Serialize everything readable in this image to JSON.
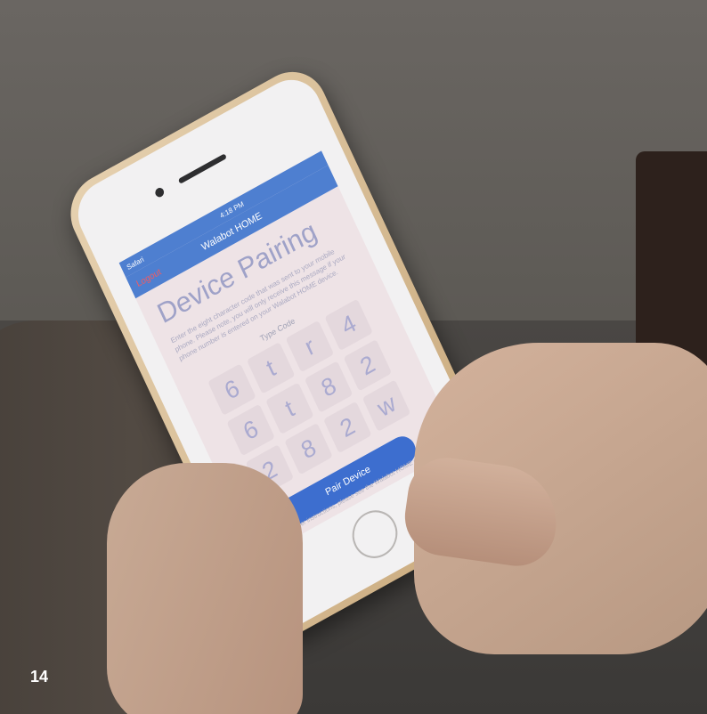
{
  "app": {
    "status_left": "Safari",
    "status_time": "4:18 PM",
    "status_right": "",
    "nav_title": "Walabot HOME",
    "logout_label": "Logout"
  },
  "screen": {
    "title": "Device Pairing",
    "instructions": "Enter the eight character code that was sent to your mobile phone. Please note, you will only receive this message if your phone number is entered on your Walabot HOME device.",
    "type_code_label": "Type Code",
    "code": [
      "6",
      "t",
      "r",
      "4",
      "6",
      "t",
      "8",
      "2",
      "2",
      "8",
      "2",
      "w"
    ],
    "pair_button": "Pair Device",
    "footer_note": "For further instructions, please see the Walabot HOME guide."
  },
  "overlay": {
    "page_number": "14"
  }
}
